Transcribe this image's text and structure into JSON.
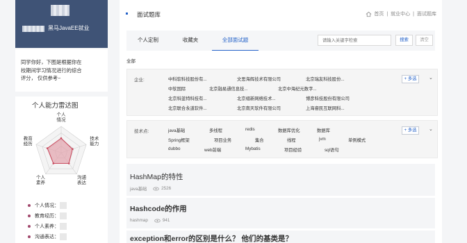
{
  "sidebar": {
    "profile_name": "黑马JavaEE就业",
    "intro": [
      "同学你好，下图是根据你在",
      "校期间学习情况进行的综合",
      "评分，  仅供参考~"
    ],
    "radar": {
      "title": "个人能力雷达图",
      "axes": [
        {
          "label": [
            "个人",
            "情况"
          ],
          "score": 0.55
        },
        {
          "label": [
            "技术",
            "能力"
          ],
          "score": 0.45
        },
        {
          "label": [
            "沟通",
            "表达"
          ],
          "score": 0.5
        },
        {
          "label": [
            "个人",
            "素养"
          ],
          "score": 0.5
        },
        {
          "label": [
            "教育",
            "经历"
          ],
          "score": 0.55
        }
      ],
      "fill_color": "#e3a3ad",
      "stroke_color": "#c9495d"
    },
    "legend": [
      "个人情况：",
      "教育经历：",
      "个人素养：",
      "沟通表达："
    ]
  },
  "header": {
    "title": "面试题库",
    "breadcrumbs": [
      "首页",
      "就业中心",
      "面试题库"
    ]
  },
  "tabs": [
    "个人定制",
    "收藏夹",
    "全部面试题"
  ],
  "active_tab": 2,
  "search": {
    "placeholder": "请输入关键字检索",
    "button": "搜索",
    "clear": "清空"
  },
  "all_label": "全部",
  "filters": {
    "company": {
      "label": "企业:",
      "items": [
        [
          "中科软科技股份有...",
          "文思海辉技术有限公司",
          "北京瑞友科技股份..."
        ],
        [
          "中软国际",
          "北京融易通信息技...",
          "北京中海纪元数字..."
        ],
        [
          "北京科蓝特科技有...",
          "北京缙新网络技术...",
          "博彦科技股份有限公司"
        ],
        [
          "北京联合永道软件...",
          "北京南天软件有限公司",
          "上海睿民互联网科..."
        ]
      ],
      "more": "+ 多选"
    },
    "tech": {
      "label": "技术点:",
      "items": [
        [
          "java基础",
          "多线程",
          "redis",
          "数据库优化",
          "数据库"
        ],
        [
          "Spring框架",
          "项目业务",
          "集合",
          "线程",
          "jvm",
          "单例模式"
        ],
        [
          "dubbo",
          "web前端",
          "Mybatis",
          "项目经验",
          "sql语句"
        ]
      ],
      "more": "+ 多选"
    }
  },
  "questions": [
    {
      "title": "HashMap的特性",
      "tag": "java基础",
      "views": "2526"
    },
    {
      "title": "Hashcode的作用",
      "tag": "hashmap",
      "views": "941"
    },
    {
      "title": "exception和error的区别是什么？ 他们的基类是？",
      "tag": "",
      "views": ""
    }
  ],
  "colors": {
    "accent": "#2361c8",
    "sidebar_header": "#3f5376",
    "legend_dot": "#a0476b"
  }
}
